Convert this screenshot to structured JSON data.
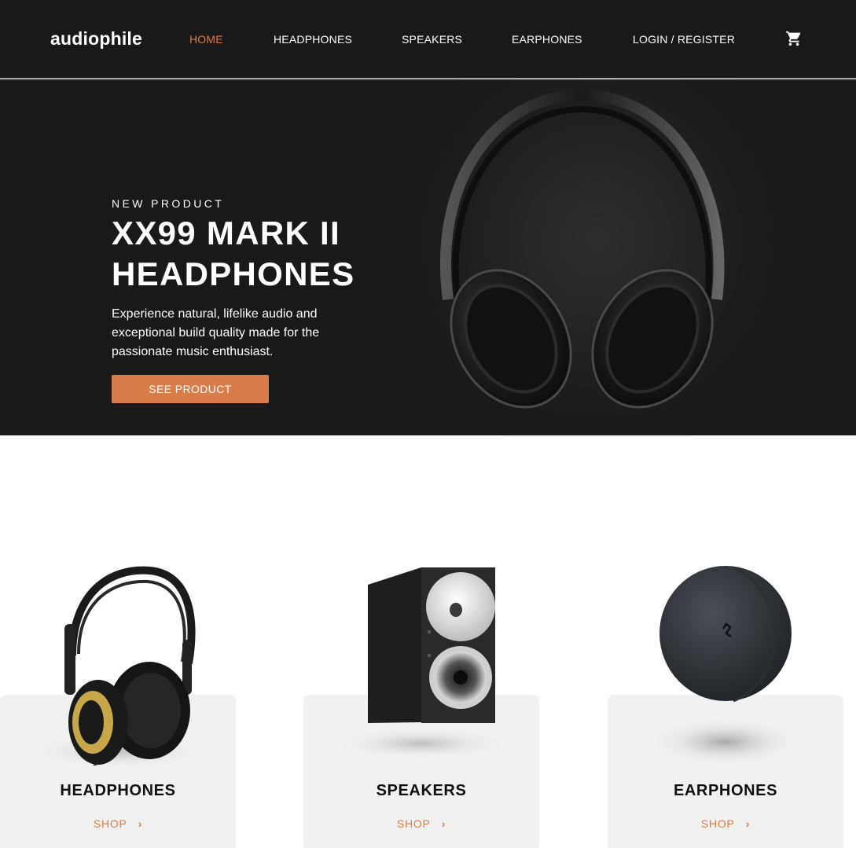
{
  "header": {
    "logo": "audiophile",
    "nav": [
      {
        "label": "HOME",
        "active": true
      },
      {
        "label": "HEADPHONES",
        "active": false
      },
      {
        "label": "SPEAKERS",
        "active": false
      },
      {
        "label": "EARPHONES",
        "active": false
      },
      {
        "label": "LOGIN / REGISTER",
        "active": false
      }
    ],
    "cart_icon": "shopping-cart-icon"
  },
  "hero": {
    "overline": "NEW PRODUCT",
    "title": "XX99 MARK II HEADPHONES",
    "description": "Experience natural, lifelike audio and exceptional build quality made for the passionate music enthusiast.",
    "button_label": "SEE PRODUCT"
  },
  "categories": [
    {
      "title": "HEADPHONES",
      "shop_label": "SHOP",
      "icon": "headphones-image"
    },
    {
      "title": "SPEAKERS",
      "shop_label": "SHOP",
      "icon": "speaker-image"
    },
    {
      "title": "EARPHONES",
      "shop_label": "SHOP",
      "icon": "earphones-case-image"
    }
  ],
  "colors": {
    "accent": "#d87d4a",
    "dark": "#191919",
    "card_bg": "#f1f1f1",
    "text": "#101010"
  }
}
